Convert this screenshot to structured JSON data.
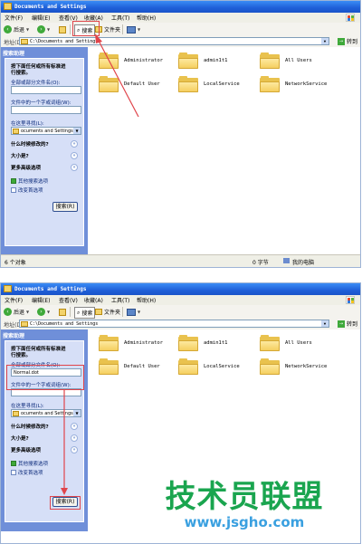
{
  "window": {
    "title": "Documents and Settings"
  },
  "menu": [
    "文件(F)",
    "编辑(E)",
    "查看(V)",
    "收藏(A)",
    "工具(T)",
    "帮助(H)"
  ],
  "toolbar": {
    "back": "后退",
    "search": "搜索",
    "folders": "文件夹"
  },
  "address": {
    "label": "地址(D)",
    "path": "C:\\Documents and Settings",
    "go": "转到"
  },
  "search_pane": {
    "header": "搜索助理",
    "prompt_line1": "按下面任何或所有标准进",
    "prompt_line2": "行搜索。",
    "name_label": "全部或部分文件名(O):",
    "name_value_panel2": "Normal.dot",
    "word_label": "文件中的一个字或词组(W):",
    "lookin_label": "在这里寻找(L):",
    "lookin_value": "ocuments and Settings",
    "when_modified": "什么时候修改的?",
    "size": "大小是?",
    "more_options": "更多高级选项",
    "other_search": "其他搜索选项",
    "change_prefs": "改变首选项",
    "search_button": "搜索(R)"
  },
  "folders": [
    "Administrator",
    "admin1t1",
    "All Users",
    "Default User",
    "LocalService",
    "NetworkService"
  ],
  "status": {
    "objects": "6 个对象",
    "size": "0 字节",
    "location": "我的电脑"
  },
  "watermark": {
    "main": "技术员联盟",
    "url": "www.jsgho.com"
  },
  "colors": {
    "highlight": "#e0454b",
    "pane": "#6f8fd9",
    "titlebar": "#1f5fd8",
    "watermark": "#1aa54f"
  }
}
